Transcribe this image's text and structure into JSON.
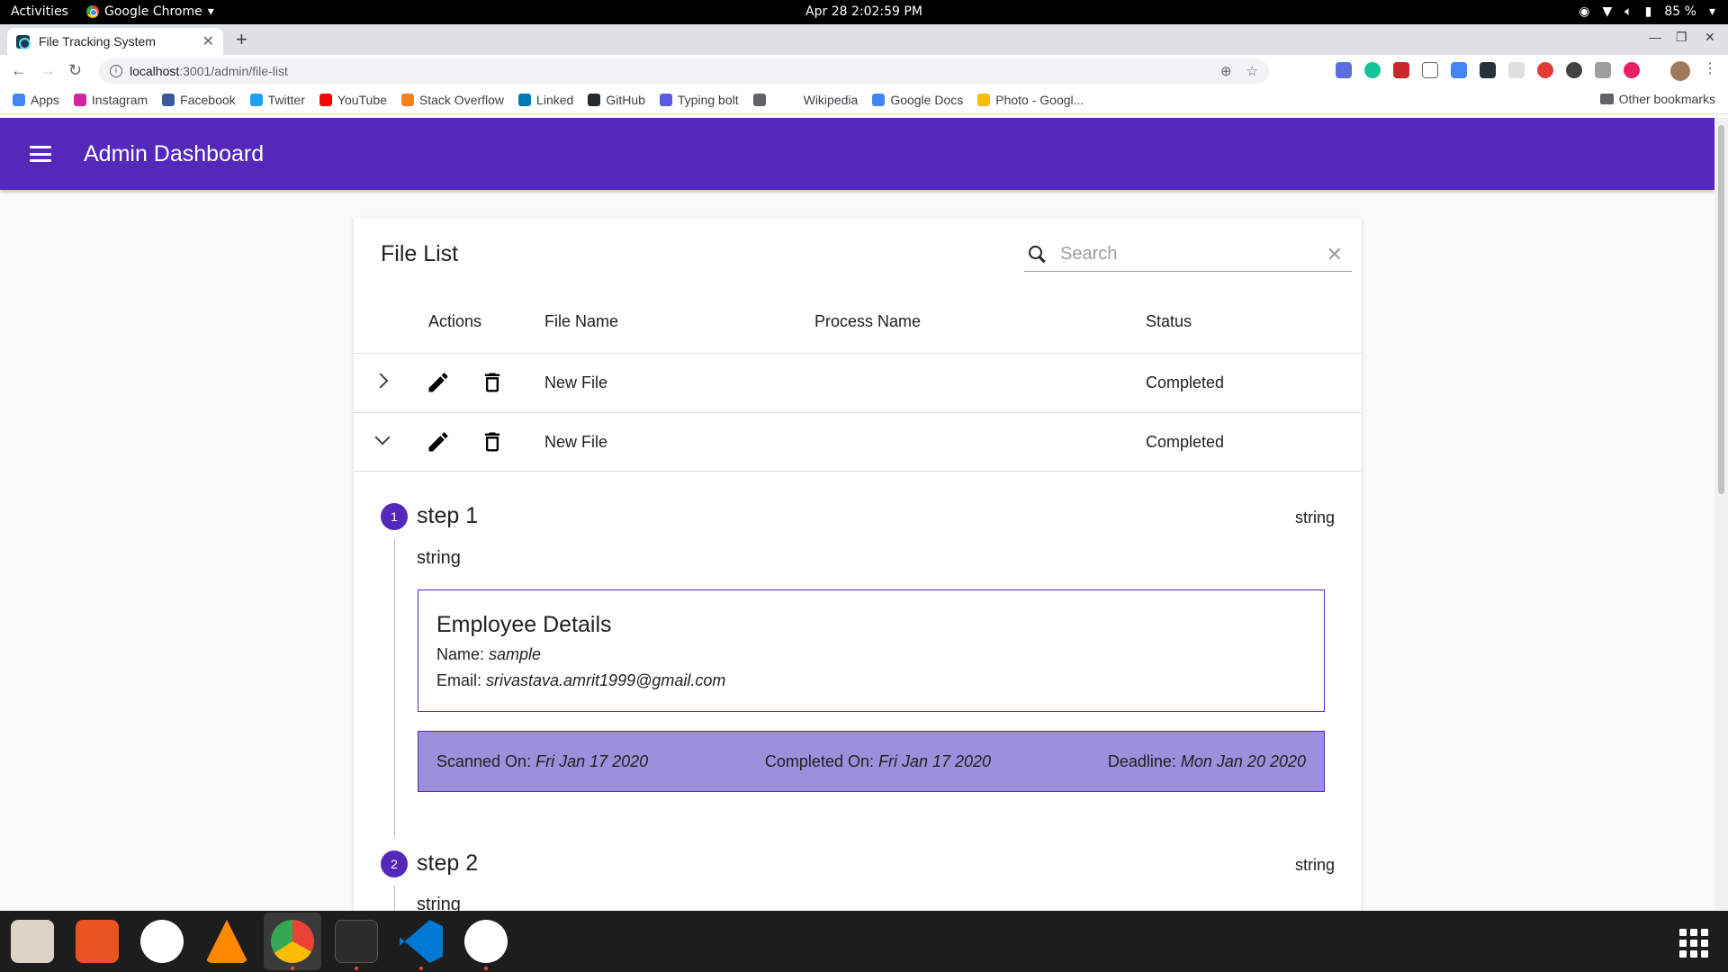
{
  "system_bar": {
    "activities": "Activities",
    "app_menu": "Google Chrome",
    "clock": "Apr 28  2:02:59 PM",
    "battery": "85 %"
  },
  "browser": {
    "tab_title": "File Tracking System",
    "url_host": "localhost",
    "url_path": ":3001/admin/file-list",
    "bookmarks": [
      {
        "label": "Apps",
        "color": "#4285f4"
      },
      {
        "label": "Instagram",
        "color": "#d6249f"
      },
      {
        "label": "Facebook",
        "color": "#3b5998"
      },
      {
        "label": "Twitter",
        "color": "#1da1f2"
      },
      {
        "label": "YouTube",
        "color": "#ff0000"
      },
      {
        "label": "Stack Overflow",
        "color": "#f48024"
      },
      {
        "label": "Linked",
        "color": "#0077b5"
      },
      {
        "label": "GitHub",
        "color": "#24292e"
      },
      {
        "label": "Typing bolt",
        "color": "#5a5ae6"
      },
      {
        "label": "",
        "color": "#5f6368"
      },
      {
        "label": "Wikipedia",
        "color": "#ffffff"
      },
      {
        "label": "Google Docs",
        "color": "#4285f4"
      },
      {
        "label": "Photo - Googl...",
        "color": "#fbbc05"
      }
    ],
    "other_bookmarks": "Other bookmarks"
  },
  "app": {
    "title": "Admin Dashboard",
    "brand_color": "#5428ba"
  },
  "file_list": {
    "title": "File List",
    "search_placeholder": "Search",
    "columns": {
      "actions": "Actions",
      "file_name": "File Name",
      "process_name": "Process Name",
      "status": "Status"
    },
    "rows": [
      {
        "file_name": "New File",
        "process_name": "",
        "status": "Completed",
        "expanded": false
      },
      {
        "file_name": "New File",
        "process_name": "",
        "status": "Completed",
        "expanded": true
      }
    ]
  },
  "steps": [
    {
      "number": "1",
      "title": "step 1",
      "right": "string",
      "description": "string",
      "employee": {
        "heading": "Employee Details",
        "name_label": "Name: ",
        "name": "sample",
        "email_label": "Email: ",
        "email": "srivastava.amrit1999@gmail.com"
      },
      "dates": {
        "scanned_label": "Scanned On: ",
        "scanned": "Fri Jan 17 2020",
        "completed_label": "Completed On: ",
        "completed": "Fri Jan 17 2020",
        "deadline_label": "Deadline: ",
        "deadline": "Mon Jan 20 2020"
      }
    },
    {
      "number": "2",
      "title": "step 2",
      "right": "string",
      "description": "string"
    }
  ]
}
